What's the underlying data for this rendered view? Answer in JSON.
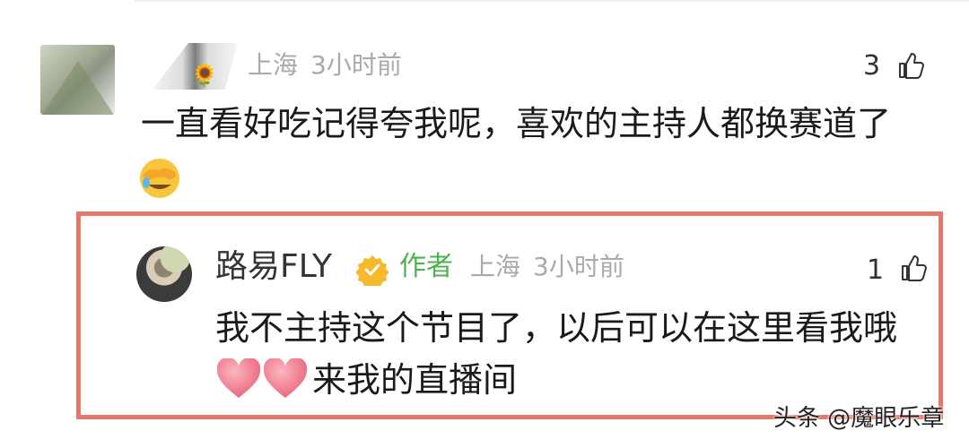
{
  "comments": [
    {
      "location": "上海",
      "time": "3小时前",
      "likes": "3",
      "text": "一直看好吃记得夸我呢，喜欢的主持人都换赛道了",
      "emoji_icon": "face-with-hand-over-eyes-emoji"
    }
  ],
  "reply": {
    "name": "路易FLY",
    "badge_icon": "verified-badge-icon",
    "author_tag": "作者",
    "location": "上海",
    "time": "3小时前",
    "likes": "1",
    "text_line1": "我不主持这个节目了，以后可以在这里看我哦",
    "text_line2": "来我的直播间",
    "highlight_color": "#e5786b"
  },
  "watermark": "头条 @魔眼乐章",
  "colors": {
    "meta_gray": "#aaaaaa",
    "author_green": "#4fb04f",
    "heart_pink": "#f07c8c"
  }
}
